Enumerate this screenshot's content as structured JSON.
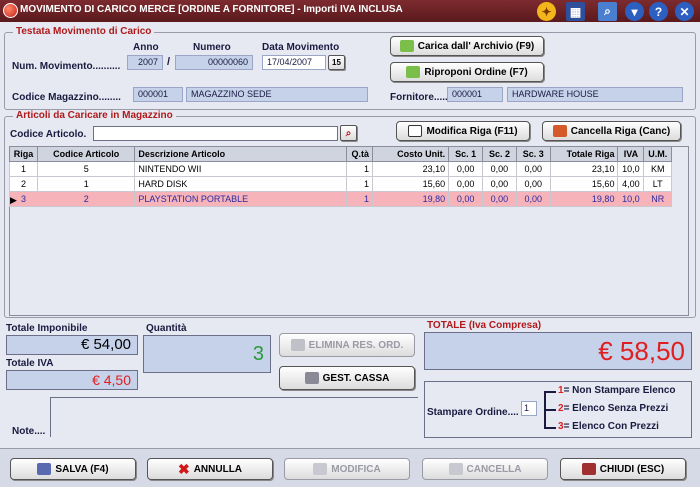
{
  "window": {
    "title": "MOVIMENTO DI CARICO MERCE [ORDINE A FORNITORE] - Importi IVA INCLUSA"
  },
  "header_group": {
    "title": "Testata Movimento di Carico",
    "anno_label": "Anno",
    "numero_label": "Numero",
    "data_label": "Data Movimento",
    "num_mov_label": "Num. Movimento..........",
    "anno": "2007",
    "separator": "/",
    "numero": "00000060",
    "data": "17/04/2007",
    "calendar_button": "15",
    "codice_mag_label": "Codice Magazzino........",
    "codice_mag": "000001",
    "magazzino_desc": "MAGAZZINO SEDE",
    "fornitore_label": "Fornitore......",
    "fornitore_code": "000001",
    "fornitore_desc": "HARDWARE HOUSE",
    "carica_button": "Carica dall' Archivio (F9)",
    "riproponi_button": "Riproponi Ordine (F7)"
  },
  "articles_group": {
    "title": "Articoli da Caricare in Magazzino",
    "codice_label": "Codice Articolo.",
    "codice_value": "",
    "modifica_button": "Modifica Riga (F11)",
    "cancella_button": "Cancella Riga (Canc)",
    "columns": [
      "Riga",
      "Codice Articolo",
      "Descrizione Articolo",
      "Q.tà",
      "Costo Unit.",
      "Sc. 1",
      "Sc. 2",
      "Sc. 3",
      "Totale Riga",
      "IVA",
      "U.M."
    ],
    "rows": [
      {
        "riga": "1",
        "codice": "5",
        "descrizione": "NINTENDO WII",
        "qta": "1",
        "costo": "23,10",
        "sc1": "0,00",
        "sc2": "0,00",
        "sc3": "0,00",
        "totale": "23,10",
        "iva": "10,0",
        "um": "KM"
      },
      {
        "riga": "2",
        "codice": "1",
        "descrizione": "HARD DISK",
        "qta": "1",
        "costo": "15,60",
        "sc1": "0,00",
        "sc2": "0,00",
        "sc3": "0,00",
        "totale": "15,60",
        "iva": "4,00",
        "um": "LT"
      },
      {
        "riga": "3",
        "codice": "2",
        "descrizione": "PLAYSTATION PORTABLE",
        "qta": "1",
        "costo": "19,80",
        "sc1": "0,00",
        "sc2": "0,00",
        "sc3": "0,00",
        "totale": "19,80",
        "iva": "10,0",
        "um": "NR"
      }
    ]
  },
  "totals": {
    "imponibile_label": "Totale Imponibile",
    "imponibile_value": "€ 54,00",
    "iva_label": "Totale IVA",
    "iva_value": "€ 4,50",
    "quantita_label": "Quantità",
    "quantita_value": "3",
    "totale_label": "TOTALE (Iva Compresa)",
    "totale_value": "€ 58,50",
    "elimina_button": "ELIMINA RES. ORD.",
    "gest_cassa_button": "GEST. CASSA",
    "note_label": "Note....",
    "note_value": ""
  },
  "print_group": {
    "label": "Stampare Ordine....",
    "value": "1",
    "options": [
      {
        "num": "1",
        "text": "= Non Stampare Elenco"
      },
      {
        "num": "2",
        "text": "= Elenco Senza Prezzi"
      },
      {
        "num": "3",
        "text": "= Elenco Con Prezzi"
      }
    ]
  },
  "footer": {
    "salva": "SALVA (F4)",
    "annulla": "ANNULLA",
    "modifica": "MODIFICA",
    "cancella": "CANCELLA",
    "chiudi": "CHIUDI (ESC)"
  },
  "colors": {
    "title_bg": "#6b2226",
    "accent_red": "#b0191b",
    "field_bg": "#c6d2ea",
    "selected_row": "#f6b3ba",
    "total_red": "#e02020",
    "qty_green": "#2a9a3a"
  }
}
